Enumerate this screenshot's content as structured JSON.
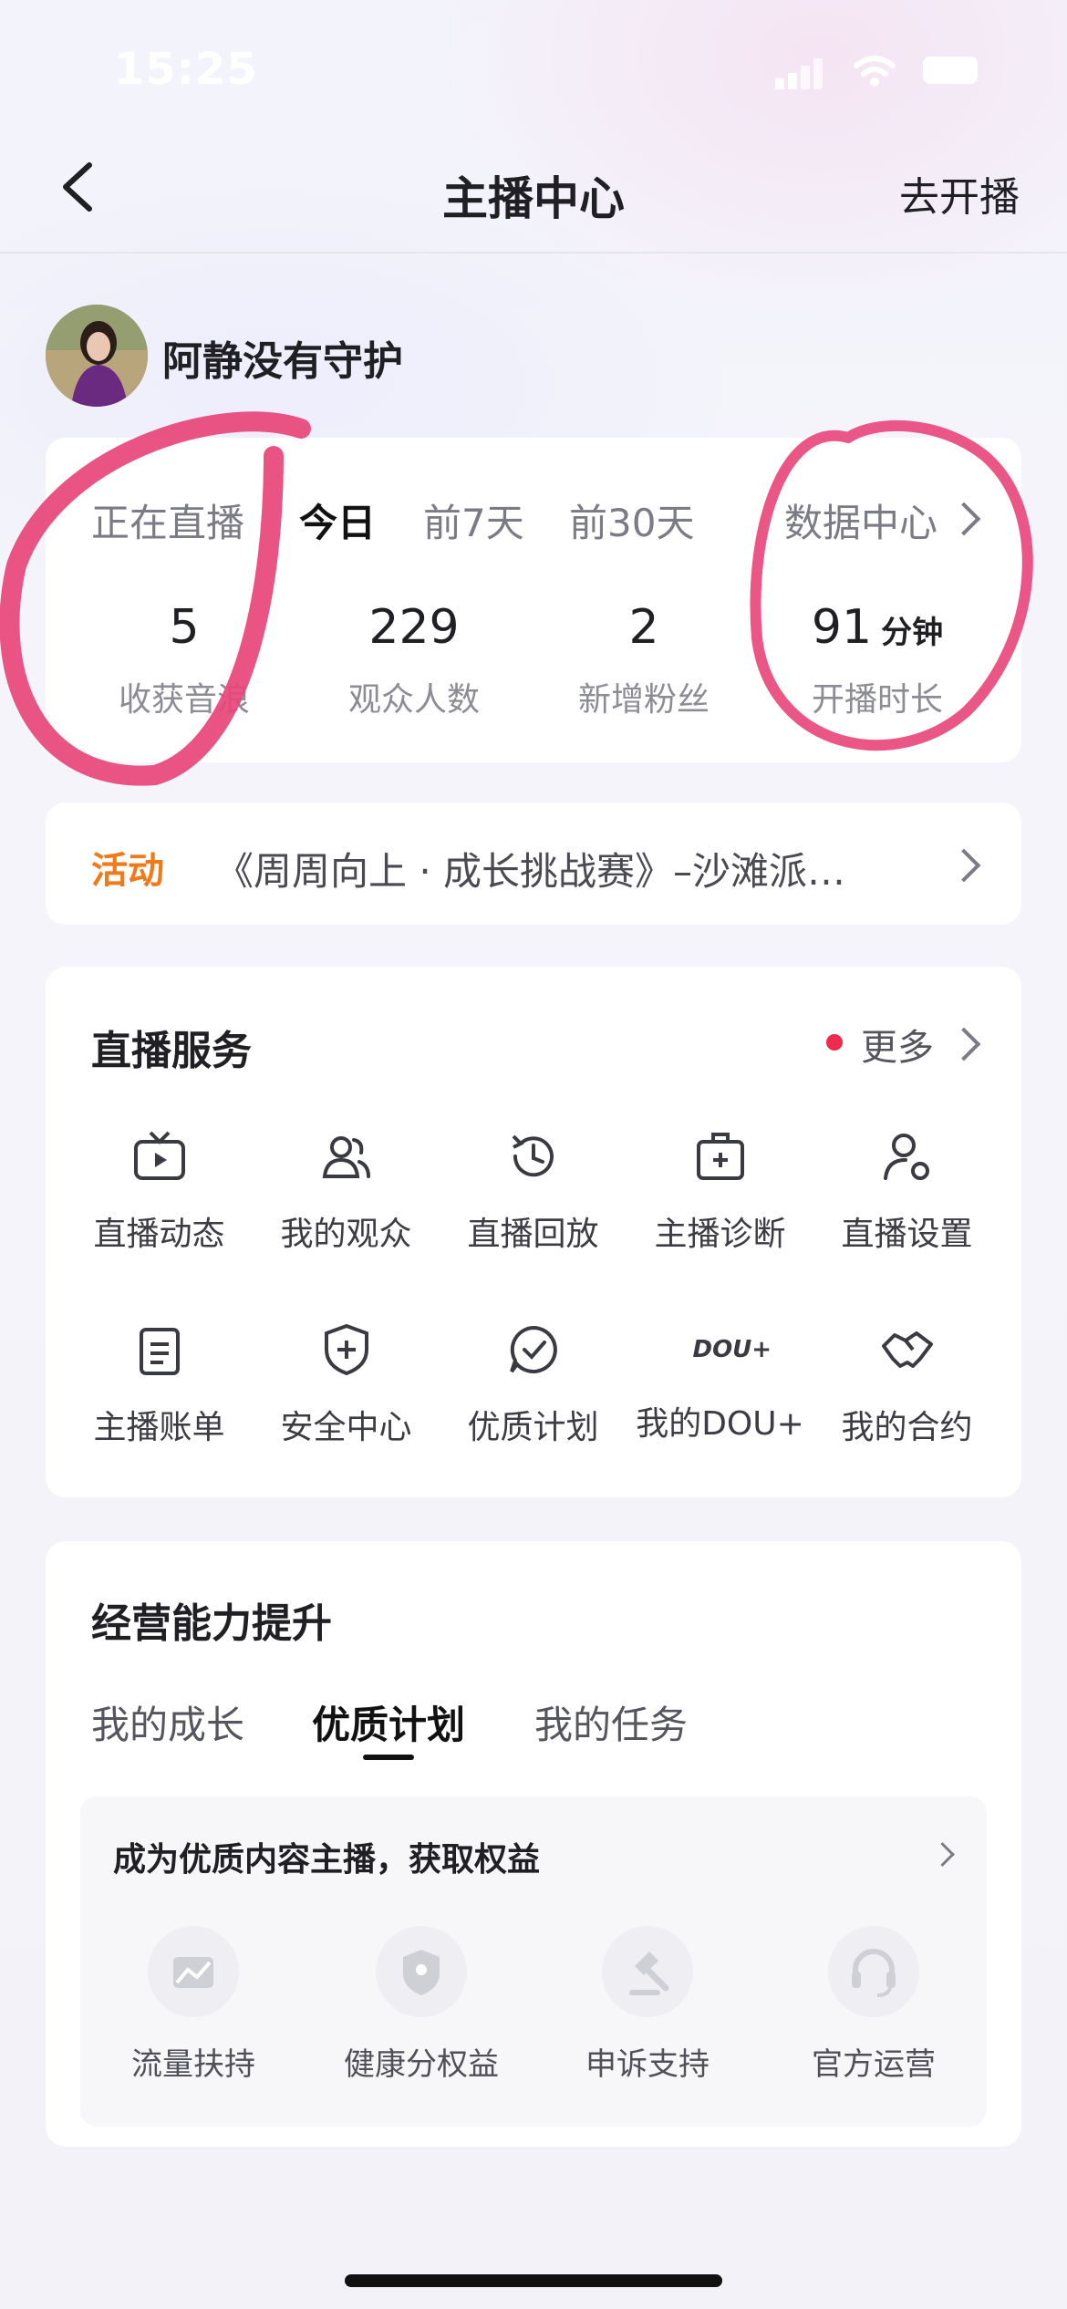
{
  "status_bar": {
    "time": "15:25"
  },
  "nav": {
    "title": "主播中心",
    "action": "去开播"
  },
  "profile": {
    "name": "阿静没有守护"
  },
  "stats_card": {
    "tabs": [
      "正在直播",
      "今日",
      "前7天",
      "前30天"
    ],
    "active_tab": "今日",
    "data_center": "数据中心",
    "stats": [
      {
        "value": "5",
        "label": "收获音浪"
      },
      {
        "value": "229",
        "label": "观众人数"
      },
      {
        "value": "2",
        "label": "新增粉丝"
      },
      {
        "value": "91",
        "unit": "分钟",
        "label": "开播时长"
      }
    ]
  },
  "activity": {
    "tag": "活动",
    "text": "《周周向上 · 成长挑战赛》–沙滩派…"
  },
  "services": {
    "title": "直播服务",
    "more": "更多",
    "items": [
      "直播动态",
      "我的观众",
      "直播回放",
      "主播诊断",
      "直播设置",
      "主播账单",
      "安全中心",
      "优质计划",
      "我的DOU+",
      "我的合约"
    ],
    "dou_icon_text": "DOU+"
  },
  "growth": {
    "title": "经营能力提升",
    "tabs": [
      "我的成长",
      "优质计划",
      "我的任务"
    ],
    "active_tab": "优质计划",
    "banner": "成为优质内容主播，获取权益",
    "perks": [
      "流量扶持",
      "健康分权益",
      "申诉支持",
      "官方运营"
    ]
  },
  "colors": {
    "accent_orange": "#f07a1a",
    "red_dot": "#ee2b4e",
    "annotation_pink": "#e8457a"
  }
}
